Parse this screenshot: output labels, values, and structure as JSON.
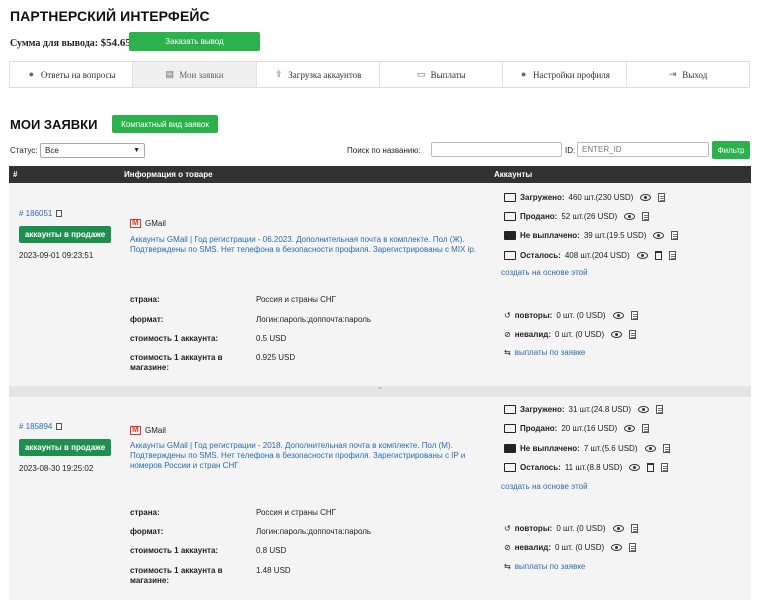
{
  "header": {
    "title": "ПАРТНЕРСКИЙ ИНТЕРФЕЙС",
    "sum_label": "Сумма для вывода:",
    "sum_value": "$54.65",
    "withdraw_button": "Заказать вывод"
  },
  "tabs": [
    {
      "label": "Ответы на вопросы",
      "icon": "chat-icon",
      "active": false
    },
    {
      "label": "Мои заявки",
      "icon": "document-icon",
      "active": true
    },
    {
      "label": "Загрузка аккаунтов",
      "icon": "upload-icon",
      "active": false
    },
    {
      "label": "Выплаты",
      "icon": "list-icon",
      "active": false
    },
    {
      "label": "Настройки профиля",
      "icon": "user-icon",
      "active": false
    },
    {
      "label": "Выход",
      "icon": "logout-icon",
      "active": false
    }
  ],
  "section": {
    "title": "МОИ ЗАЯВКИ",
    "compact_button": "Компактный вид заявок"
  },
  "filters": {
    "status_label": "Статус:",
    "status_value": "Все",
    "search_label": "Поиск по названию:",
    "search_value": "",
    "id_label": "ID:",
    "id_placeholder": "ENTER_ID",
    "filter_button": "Фильтр"
  },
  "table": {
    "col_num": "#",
    "col_info": "Информация о товаре",
    "col_accounts": "Аккаунты"
  },
  "orders": [
    {
      "id": "# 186051",
      "status": "аккаунты в продаже",
      "date": "2023-09-01 09:23:51",
      "product": "GMail",
      "description": "Аккаунты GMail | Год регистрации - 06.2023. Дополнительная почта в комплекте. Пол (Ж). Подтверждены по SMS. Нет телефона в безопасности профиля. Зарегистрированы с MIX ip.",
      "props": {
        "country_label": "страна:",
        "country": "Россия и страны СНГ",
        "format_label": "формат:",
        "format": "Логин:пароль:доппочта:пароль",
        "cost_label": "стоимость 1 аккаунта:",
        "cost": "0.5 USD",
        "shop_cost_label": "стоимость 1 аккаунта в магазине:",
        "shop_cost": "0.925 USD"
      },
      "accounts": {
        "loaded_label": "Загружено:",
        "loaded": "460 шт.(230 USD)",
        "sold_label": "Продано:",
        "sold": "52 шт.(26 USD)",
        "unpaid_label": "Не выплачено:",
        "unpaid": "39 шт.(19.5 USD)",
        "left_label": "Осталось:",
        "left": "408 шт.(204 USD)",
        "create_link": "создать на основе этой",
        "repeats_label": "повторы:",
        "repeats": "0 шт. (0 USD)",
        "invalid_label": "невалид:",
        "invalid": "0 шт. (0 USD)",
        "payouts_link": "выплаты по заявке"
      }
    },
    {
      "id": "# 185894",
      "status": "аккаунты в продаже",
      "date": "2023-08-30 19:25:02",
      "product": "GMail",
      "description": "Аккаунты GMail | Год регистрации - 2018. Дополнительная почта в комплекте. Пол (М). Подтверждены по SMS. Нет телефона в безопасности профиля. Зарегистрированы с IP и номеров России и стран СНГ",
      "props": {
        "country_label": "страна:",
        "country": "Россия и страны СНГ",
        "format_label": "формат:",
        "format": "Логин:пароль:доппочта:пароль",
        "cost_label": "стоимость 1 аккаунта:",
        "cost": "0.8 USD",
        "shop_cost_label": "стоимость 1 аккаунта в магазине:",
        "shop_cost": "1.48 USD"
      },
      "accounts": {
        "loaded_label": "Загружено:",
        "loaded": "31 шт.(24.8 USD)",
        "sold_label": "Продано:",
        "sold": "20 шт.(16 USD)",
        "unpaid_label": "Не выплачено:",
        "unpaid": "7 шт.(5.6 USD)",
        "left_label": "Осталось:",
        "left": "11 шт.(8.8 USD)",
        "create_link": "создать на основе этой",
        "repeats_label": "повторы:",
        "repeats": "0 шт. (0 USD)",
        "invalid_label": "невалид:",
        "invalid": "0 шт. (0 USD)",
        "payouts_link": "выплаты по заявке"
      }
    }
  ],
  "colors": {
    "green": "#2bb24c",
    "badge_green": "#1f8f4f",
    "link_blue": "#2a6db3",
    "table_header": "#323232"
  }
}
